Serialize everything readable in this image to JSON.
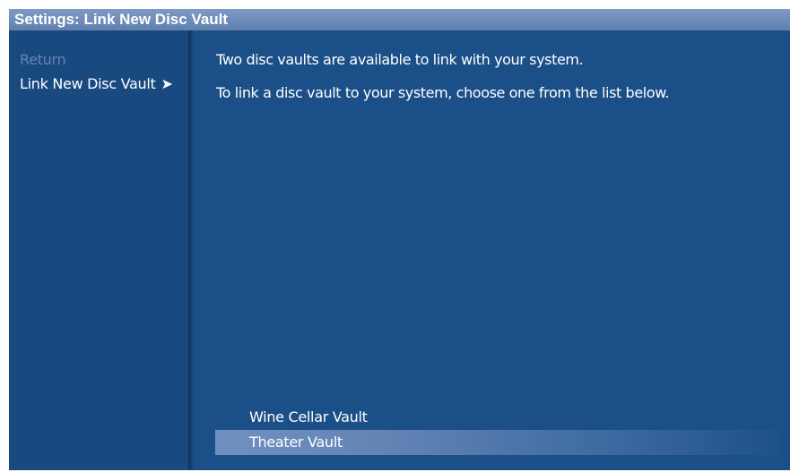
{
  "title_bar": {
    "title": "Settings: Link New Disc Vault"
  },
  "sidebar": {
    "items": [
      {
        "label": "Return",
        "state": "dimmed"
      },
      {
        "label": "Link New Disc Vault",
        "state": "active",
        "icon": "chevron-right-icon"
      }
    ]
  },
  "main": {
    "message_1": "Two disc vaults are available to link with your system.",
    "message_2": "To link a disc vault to your system, choose one from the list below.",
    "vaults": [
      {
        "label": "Wine Cellar Vault",
        "selected": false
      },
      {
        "label": "Theater Vault",
        "selected": true
      }
    ]
  },
  "colors": {
    "background": "#1b4f87",
    "title_bar": "#6e8cb8",
    "dimmed_text": "#6485ae",
    "text": "#ffffff",
    "selection": "#6f90c0"
  }
}
